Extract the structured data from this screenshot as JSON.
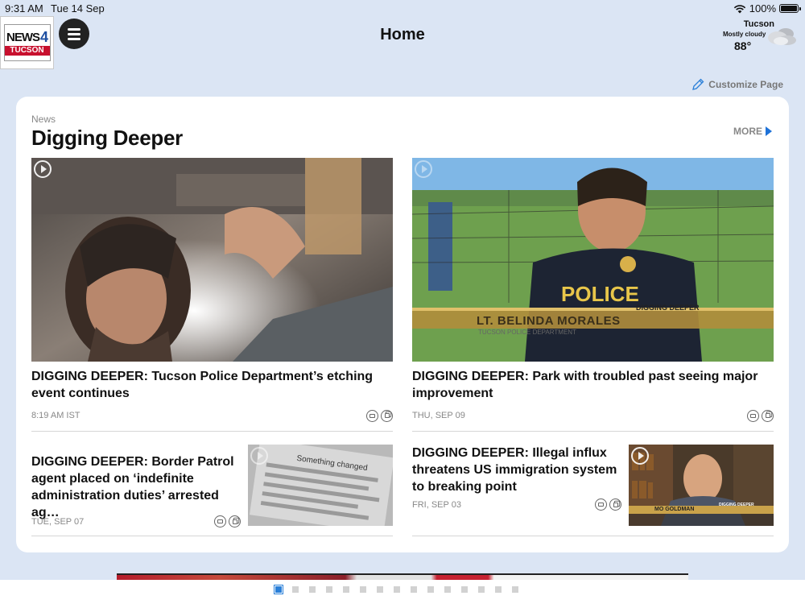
{
  "status_bar": {
    "time": "9:31 AM",
    "date": "Tue 14 Sep",
    "battery": "100%"
  },
  "header": {
    "logo": {
      "line1": "NEWS",
      "number": "4",
      "line2": "TUCSON"
    },
    "title": "Home",
    "weather": {
      "city": "Tucson",
      "condition": "Mostly cloudy",
      "temperature": "88°",
      "icon": "cloudy-icon"
    }
  },
  "toolbar": {
    "customize_label": "Customize Page",
    "customize_icon": "pencil-icon"
  },
  "section": {
    "label": "News",
    "title": "Digging Deeper",
    "more_label": "MORE",
    "stories": [
      {
        "headline": "DIGGING DEEPER: Tucson Police Department’s etching event continues",
        "time": "8:19 AM IST",
        "thumb": "mechanic under car"
      },
      {
        "headline": "DIGGING DEEPER: Park with troubled past seeing major improvement",
        "time": "THU, SEP 09",
        "overlay": {
          "tag": "DIGGING DEEPER",
          "name": "LT. BELINDA MORALES",
          "org": "TUCSON POLICE DEPARTMENT"
        }
      },
      {
        "headline": "DIGGING DEEPER: Border Patrol agent placed on ‘indefinite administration duties’ arrested ag…",
        "time": "TUE, SEP 07",
        "thumb_text": "Something changed"
      },
      {
        "headline": "DIGGING DEEPER: Illegal influx threatens US immigration system to breaking point",
        "time": "FRI, SEP 03",
        "overlay": {
          "tag": "DIGGING DEEPER",
          "name": "MO GOLDMAN"
        }
      }
    ]
  },
  "pager": {
    "total": 15,
    "current": 1
  },
  "colors": {
    "accent": "#1e72d8",
    "background": "#dbe5f4",
    "logo_red": "#c8102e",
    "logo_blue": "#1e4fa1"
  }
}
